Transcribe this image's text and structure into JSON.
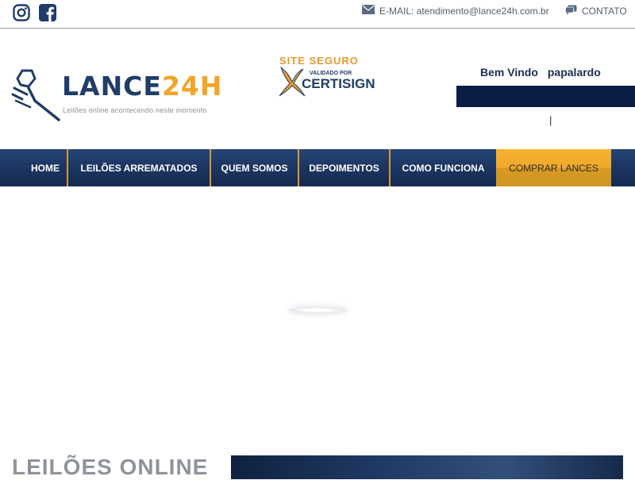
{
  "topbar": {
    "email_label": "E-MAIL: atendimento@lance24h.com.br",
    "contato_label": "CONTATO",
    "icons": [
      "instagram-icon",
      "facebook-icon",
      "mail-icon",
      "chat-icon"
    ]
  },
  "logo": {
    "brand_part1": "LANCE",
    "brand_part2": "24H",
    "tagline": "Leilões online acontecendo neste momento"
  },
  "seal": {
    "title": "SITE SEGURO",
    "validated": "VALIDADO POR",
    "issuer": "CERTISIGN"
  },
  "user": {
    "greeting": "Bem Vindo",
    "username": "papalardo",
    "separator": "|"
  },
  "nav": {
    "items": [
      "HOME",
      "LEILÕES ARREMATADOS",
      "QUEM SOMOS",
      "DEPOIMENTOS",
      "COMO FUNCIONA"
    ],
    "cta": "COMPRAR LANCES"
  },
  "content": {
    "section_title": "LEILÕES ONLINE"
  },
  "colors": {
    "brand_navy": "#1f3d68",
    "brand_orange": "#f3a42b",
    "nav_background": "#1c3560",
    "cta_background": "#f0a92a"
  }
}
